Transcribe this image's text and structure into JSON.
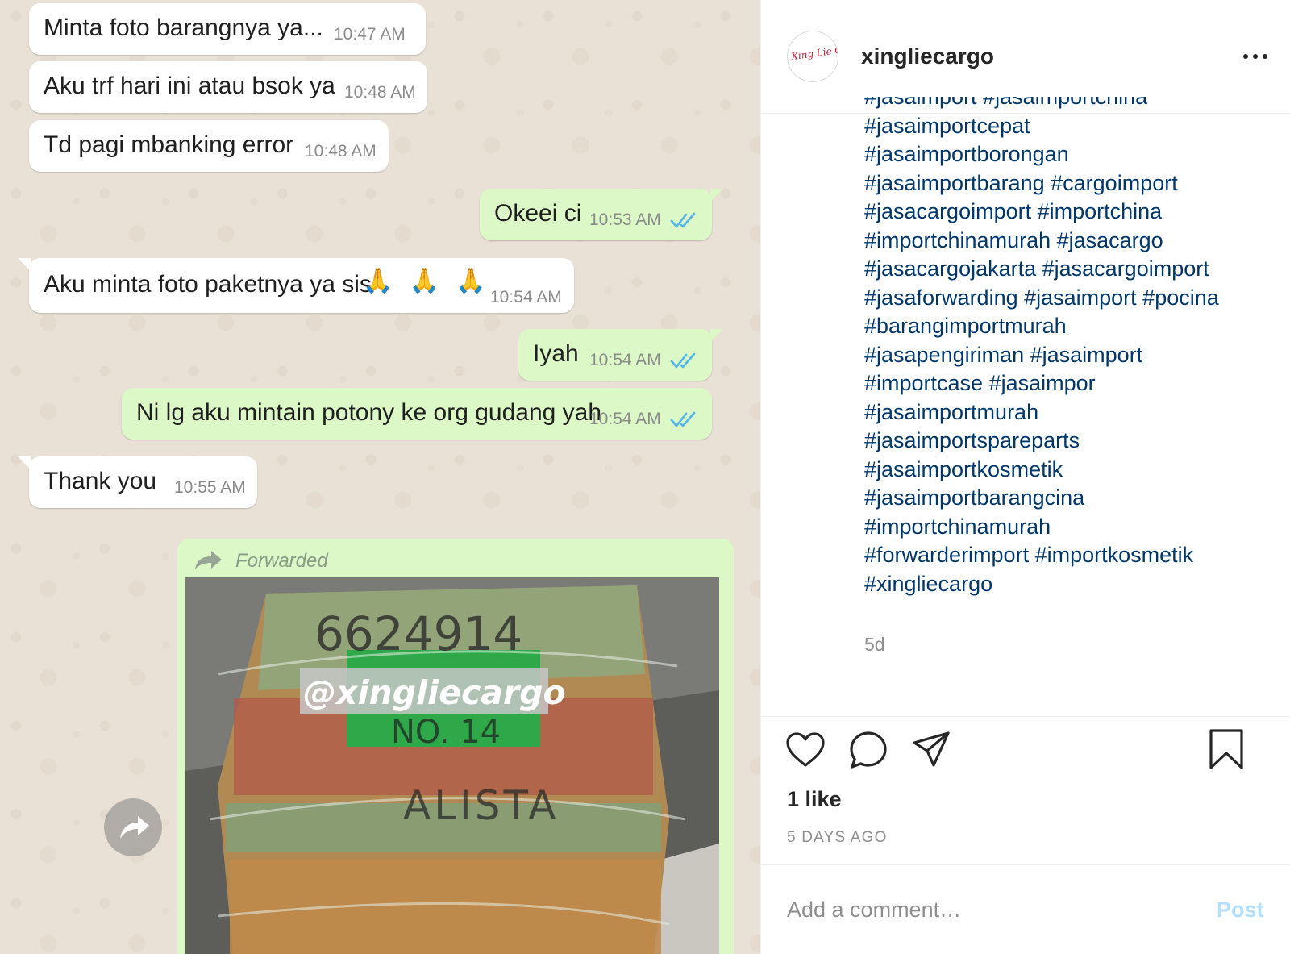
{
  "chat": {
    "messages": [
      {
        "text": "Minta foto barangnya ya...",
        "time": "10:47 AM",
        "direction": "in"
      },
      {
        "text": "Aku trf hari ini atau bsok ya",
        "time": "10:48 AM",
        "direction": "in"
      },
      {
        "text": "Td pagi mbanking error",
        "time": "10:48 AM",
        "direction": "in"
      },
      {
        "text": "Okeei ci",
        "time": "10:53 AM",
        "direction": "out"
      },
      {
        "text": "Aku minta foto paketnya ya sis",
        "emoji": "🙏 🙏 🙏",
        "time": "10:54 AM",
        "direction": "in"
      },
      {
        "text": "Iyah",
        "time": "10:54 AM",
        "direction": "out"
      },
      {
        "text": "Ni lg aku mintain potony ke org gudang yah",
        "time": "10:54 AM",
        "direction": "out"
      },
      {
        "text": "Thank you",
        "time": "10:55 AM",
        "direction": "in"
      }
    ],
    "forwarded": {
      "label": "Forwarded",
      "watermark": "@xingliecargo",
      "box_writing": [
        "6624914",
        "NO. 14",
        "ALISTA"
      ]
    },
    "colors": {
      "incoming": "#ffffff",
      "outgoing": "#dcf8c6",
      "read_ticks": "#4fb6ec"
    }
  },
  "post": {
    "username": "xingliecargo",
    "avatar_text": "Xing Lie Cargo",
    "caption_lines": [
      "#jasaimport #jasaimportchina",
      "#jasaimportcepat",
      "#jasaimportborongan",
      "#jasaimportbarang #cargoimport",
      "#jasacargoimport #importchina",
      "#importchinamurah #jasacargo",
      "#jasacargojakarta #jasacargoimport",
      "#jasaforwarding #jasaimport #pocina",
      "#barangimportmurah",
      "#jasapengiriman #jasaimport",
      "#importcase #jasaimpor",
      "#jasaimportmurah",
      "#jasaimportspareparts",
      "#jasaimportkosmetik",
      "#jasaimportbarangcina",
      "#importchinamurah",
      "#forwarderimport #importkosmetik",
      "#xingliecargo"
    ],
    "caption_age": "5d",
    "likes": "1 like",
    "date": "5 DAYS AGO",
    "comment_placeholder": "Add a comment…",
    "post_label": "Post",
    "icons": [
      "more-icon",
      "heart-icon",
      "comment-icon",
      "share-icon",
      "bookmark-icon"
    ],
    "colors": {
      "hashtag": "#00376b",
      "post_button": "#b2dffc"
    }
  }
}
